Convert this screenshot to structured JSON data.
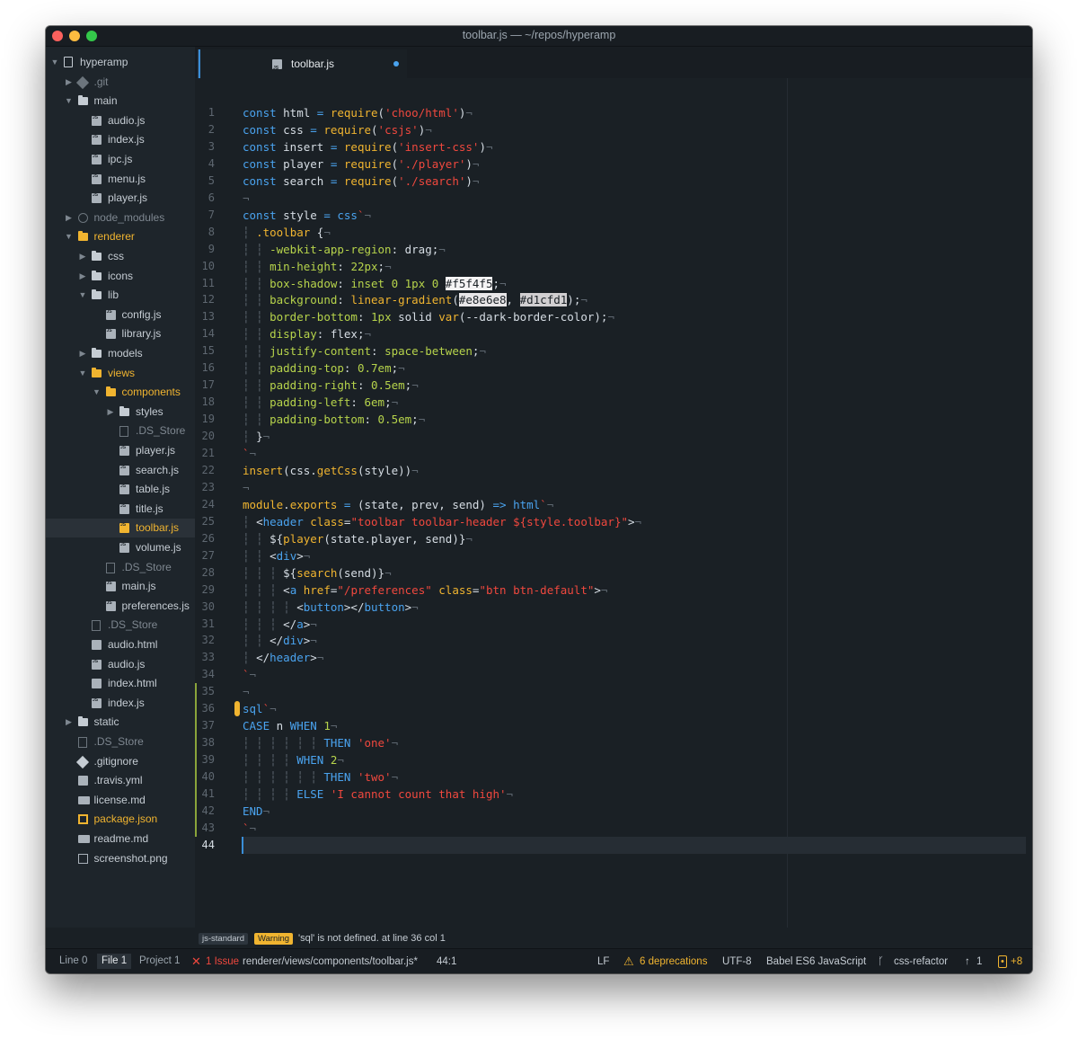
{
  "window": {
    "title": "toolbar.js — ~/repos/hyperamp"
  },
  "tree": [
    {
      "label": "hyperamp",
      "depth": 0,
      "arrow": "down",
      "icon": "repo-icon"
    },
    {
      "label": ".git",
      "depth": 1,
      "arrow": "right",
      "icon": "git-icon",
      "dim": true
    },
    {
      "label": "main",
      "depth": 1,
      "arrow": "down",
      "icon": "folder-icon"
    },
    {
      "label": "audio.js",
      "depth": 2,
      "icon": "js-file-icon"
    },
    {
      "label": "index.js",
      "depth": 2,
      "icon": "js-file-icon"
    },
    {
      "label": "ipc.js",
      "depth": 2,
      "icon": "js-file-icon"
    },
    {
      "label": "menu.js",
      "depth": 2,
      "icon": "js-file-icon"
    },
    {
      "label": "player.js",
      "depth": 2,
      "icon": "js-file-icon"
    },
    {
      "label": "node_modules",
      "depth": 1,
      "arrow": "right",
      "icon": "node-modules-icon",
      "dim": true
    },
    {
      "label": "renderer",
      "depth": 1,
      "arrow": "down",
      "icon": "folder-icon",
      "gold": true
    },
    {
      "label": "css",
      "depth": 2,
      "arrow": "right",
      "icon": "folder-icon"
    },
    {
      "label": "icons",
      "depth": 2,
      "arrow": "right",
      "icon": "folder-icon"
    },
    {
      "label": "lib",
      "depth": 2,
      "arrow": "down",
      "icon": "folder-icon"
    },
    {
      "label": "config.js",
      "depth": 3,
      "icon": "js-file-icon"
    },
    {
      "label": "library.js",
      "depth": 3,
      "icon": "js-file-icon"
    },
    {
      "label": "models",
      "depth": 2,
      "arrow": "right",
      "icon": "folder-icon"
    },
    {
      "label": "views",
      "depth": 2,
      "arrow": "down",
      "icon": "folder-icon",
      "gold": true
    },
    {
      "label": "components",
      "depth": 3,
      "arrow": "down",
      "icon": "folder-icon",
      "gold": true
    },
    {
      "label": "styles",
      "depth": 4,
      "arrow": "right",
      "icon": "folder-icon"
    },
    {
      "label": ".DS_Store",
      "depth": 4,
      "icon": "plain-file-icon",
      "dim": true
    },
    {
      "label": "player.js",
      "depth": 4,
      "icon": "js-file-icon"
    },
    {
      "label": "search.js",
      "depth": 4,
      "icon": "js-file-icon"
    },
    {
      "label": "table.js",
      "depth": 4,
      "icon": "js-file-icon"
    },
    {
      "label": "title.js",
      "depth": 4,
      "icon": "js-file-icon"
    },
    {
      "label": "toolbar.js",
      "depth": 4,
      "icon": "js-file-icon",
      "gold": true,
      "selected": true
    },
    {
      "label": "volume.js",
      "depth": 4,
      "icon": "js-file-icon"
    },
    {
      "label": ".DS_Store",
      "depth": 3,
      "icon": "plain-file-icon",
      "dim": true
    },
    {
      "label": "main.js",
      "depth": 3,
      "icon": "js-file-icon"
    },
    {
      "label": "preferences.js",
      "depth": 3,
      "icon": "js-file-icon"
    },
    {
      "label": ".DS_Store",
      "depth": 2,
      "icon": "plain-file-icon",
      "dim": true
    },
    {
      "label": "audio.html",
      "depth": 2,
      "icon": "html-file-icon"
    },
    {
      "label": "audio.js",
      "depth": 2,
      "icon": "js-file-icon"
    },
    {
      "label": "index.html",
      "depth": 2,
      "icon": "html-file-icon"
    },
    {
      "label": "index.js",
      "depth": 2,
      "icon": "js-file-icon"
    },
    {
      "label": "static",
      "depth": 1,
      "arrow": "right",
      "icon": "folder-icon"
    },
    {
      "label": ".DS_Store",
      "depth": 1,
      "icon": "plain-file-icon",
      "dim": true
    },
    {
      "label": ".gitignore",
      "depth": 1,
      "icon": "git-icon"
    },
    {
      "label": ".travis.yml",
      "depth": 1,
      "icon": "yml-file-icon"
    },
    {
      "label": "license.md",
      "depth": 1,
      "icon": "md-file-icon"
    },
    {
      "label": "package.json",
      "depth": 1,
      "icon": "json-file-icon",
      "gold": true
    },
    {
      "label": "readme.md",
      "depth": 1,
      "icon": "md-file-icon"
    },
    {
      "label": "screenshot.png",
      "depth": 1,
      "icon": "image-file-icon"
    }
  ],
  "tab": {
    "label": "toolbar.js",
    "modified": true
  },
  "editor": {
    "active_line": 44,
    "warning_line": 36,
    "modified_lines": [
      35,
      43
    ],
    "lines": [
      [
        [
          "k",
          "const "
        ],
        [
          "p",
          "html "
        ],
        [
          "k",
          "= "
        ],
        [
          "f",
          "require"
        ],
        [
          "p",
          "("
        ],
        [
          "s",
          "'choo/html'"
        ],
        [
          "p",
          ")"
        ],
        [
          "inv",
          "¬"
        ]
      ],
      [
        [
          "k",
          "const "
        ],
        [
          "p",
          "css "
        ],
        [
          "k",
          "= "
        ],
        [
          "f",
          "require"
        ],
        [
          "p",
          "("
        ],
        [
          "s",
          "'csjs'"
        ],
        [
          "p",
          ")"
        ],
        [
          "inv",
          "¬"
        ]
      ],
      [
        [
          "k",
          "const "
        ],
        [
          "p",
          "insert "
        ],
        [
          "k",
          "= "
        ],
        [
          "f",
          "require"
        ],
        [
          "p",
          "("
        ],
        [
          "s",
          "'insert-css'"
        ],
        [
          "p",
          ")"
        ],
        [
          "inv",
          "¬"
        ]
      ],
      [
        [
          "k",
          "const "
        ],
        [
          "p",
          "player "
        ],
        [
          "k",
          "= "
        ],
        [
          "f",
          "require"
        ],
        [
          "p",
          "("
        ],
        [
          "s",
          "'./player'"
        ],
        [
          "p",
          ")"
        ],
        [
          "inv",
          "¬"
        ]
      ],
      [
        [
          "k",
          "const "
        ],
        [
          "p",
          "search "
        ],
        [
          "k",
          "= "
        ],
        [
          "f",
          "require"
        ],
        [
          "p",
          "("
        ],
        [
          "s",
          "'./search'"
        ],
        [
          "p",
          ")"
        ],
        [
          "inv",
          "¬"
        ]
      ],
      [
        [
          "inv",
          "¬"
        ]
      ],
      [
        [
          "k",
          "const "
        ],
        [
          "p",
          "style "
        ],
        [
          "k",
          "= "
        ],
        [
          "k",
          "css"
        ],
        [
          "s",
          "`"
        ],
        [
          "inv",
          "¬"
        ]
      ],
      [
        [
          "inv",
          "┆ "
        ],
        [
          "y",
          ".toolbar "
        ],
        [
          "p",
          "{"
        ],
        [
          "inv",
          "¬"
        ]
      ],
      [
        [
          "inv",
          "┆ ┆ "
        ],
        [
          "pr",
          "-webkit-app-region"
        ],
        [
          "p",
          ": drag;"
        ],
        [
          "inv",
          "¬"
        ]
      ],
      [
        [
          "inv",
          "┆ ┆ "
        ],
        [
          "pr",
          "min-height"
        ],
        [
          "p",
          ": "
        ],
        [
          "n",
          "22px"
        ],
        [
          "p",
          ";"
        ],
        [
          "inv",
          "¬"
        ]
      ],
      [
        [
          "inv",
          "┆ ┆ "
        ],
        [
          "pr",
          "box-shadow"
        ],
        [
          "p",
          ": "
        ],
        [
          "n",
          "inset 0 1px 0 "
        ],
        [
          "sw-w",
          "#f5f4f5"
        ],
        [
          "p",
          ";"
        ],
        [
          "inv",
          "¬"
        ]
      ],
      [
        [
          "inv",
          "┆ ┆ "
        ],
        [
          "pr",
          "background"
        ],
        [
          "p",
          ": "
        ],
        [
          "f",
          "linear-gradient"
        ],
        [
          "p",
          "("
        ],
        [
          "sw-g",
          "#e8e6e8"
        ],
        [
          "p",
          ", "
        ],
        [
          "sw-d",
          "#d1cfd1"
        ],
        [
          "p",
          ");"
        ],
        [
          "inv",
          "¬"
        ]
      ],
      [
        [
          "inv",
          "┆ ┆ "
        ],
        [
          "pr",
          "border-bottom"
        ],
        [
          "p",
          ": "
        ],
        [
          "n",
          "1px "
        ],
        [
          "p",
          "solid "
        ],
        [
          "f",
          "var"
        ],
        [
          "p",
          "(--dark-border-color);"
        ],
        [
          "inv",
          "¬"
        ]
      ],
      [
        [
          "inv",
          "┆ ┆ "
        ],
        [
          "pr",
          "display"
        ],
        [
          "p",
          ": flex;"
        ],
        [
          "inv",
          "¬"
        ]
      ],
      [
        [
          "inv",
          "┆ ┆ "
        ],
        [
          "pr",
          "justify-content"
        ],
        [
          "p",
          ": "
        ],
        [
          "n",
          "space-between"
        ],
        [
          "p",
          ";"
        ],
        [
          "inv",
          "¬"
        ]
      ],
      [
        [
          "inv",
          "┆ ┆ "
        ],
        [
          "pr",
          "padding-top"
        ],
        [
          "p",
          ": "
        ],
        [
          "n",
          "0.7em"
        ],
        [
          "p",
          ";"
        ],
        [
          "inv",
          "¬"
        ]
      ],
      [
        [
          "inv",
          "┆ ┆ "
        ],
        [
          "pr",
          "padding-right"
        ],
        [
          "p",
          ": "
        ],
        [
          "n",
          "0.5em"
        ],
        [
          "p",
          ";"
        ],
        [
          "inv",
          "¬"
        ]
      ],
      [
        [
          "inv",
          "┆ ┆ "
        ],
        [
          "pr",
          "padding-left"
        ],
        [
          "p",
          ": "
        ],
        [
          "n",
          "6em"
        ],
        [
          "p",
          ";"
        ],
        [
          "inv",
          "¬"
        ]
      ],
      [
        [
          "inv",
          "┆ ┆ "
        ],
        [
          "pr",
          "padding-bottom"
        ],
        [
          "p",
          ": "
        ],
        [
          "n",
          "0.5em"
        ],
        [
          "p",
          ";"
        ],
        [
          "inv",
          "¬"
        ]
      ],
      [
        [
          "inv",
          "┆ "
        ],
        [
          "p",
          "}"
        ],
        [
          "inv",
          "¬"
        ]
      ],
      [
        [
          "s",
          "`"
        ],
        [
          "inv",
          "¬"
        ]
      ],
      [
        [
          "f",
          "insert"
        ],
        [
          "p",
          "(css."
        ],
        [
          "f",
          "getCss"
        ],
        [
          "p",
          "(style))"
        ],
        [
          "inv",
          "¬"
        ]
      ],
      [
        [
          "inv",
          "¬"
        ]
      ],
      [
        [
          "f",
          "module"
        ],
        [
          "p",
          "."
        ],
        [
          "f",
          "exports "
        ],
        [
          "k",
          "= "
        ],
        [
          "p",
          "(state, prev, send) "
        ],
        [
          "k",
          "=> "
        ],
        [
          "k",
          "html"
        ],
        [
          "s",
          "`"
        ],
        [
          "inv",
          "¬"
        ]
      ],
      [
        [
          "inv",
          "┆ "
        ],
        [
          "p",
          "<"
        ],
        [
          "k",
          "header "
        ],
        [
          "y",
          "class"
        ],
        [
          "p",
          "="
        ],
        [
          "s",
          "\"toolbar toolbar-header ${style.toolbar}\""
        ],
        [
          "p",
          ">"
        ],
        [
          "inv",
          "¬"
        ]
      ],
      [
        [
          "inv",
          "┆ ┆ "
        ],
        [
          "p",
          "${"
        ],
        [
          "f",
          "player"
        ],
        [
          "p",
          "(state.player, send)}"
        ],
        [
          "inv",
          "¬"
        ]
      ],
      [
        [
          "inv",
          "┆ ┆ "
        ],
        [
          "p",
          "<"
        ],
        [
          "k",
          "div"
        ],
        [
          "p",
          ">"
        ],
        [
          "inv",
          "¬"
        ]
      ],
      [
        [
          "inv",
          "┆ ┆ ┆ "
        ],
        [
          "p",
          "${"
        ],
        [
          "f",
          "search"
        ],
        [
          "p",
          "(send)}"
        ],
        [
          "inv",
          "¬"
        ]
      ],
      [
        [
          "inv",
          "┆ ┆ ┆ "
        ],
        [
          "p",
          "<"
        ],
        [
          "k",
          "a "
        ],
        [
          "y",
          "href"
        ],
        [
          "p",
          "="
        ],
        [
          "s",
          "\"/preferences\" "
        ],
        [
          "y",
          "class"
        ],
        [
          "p",
          "="
        ],
        [
          "s",
          "\"btn btn-default\""
        ],
        [
          "p",
          ">"
        ],
        [
          "inv",
          "¬"
        ]
      ],
      [
        [
          "inv",
          "┆ ┆ ┆ ┆ "
        ],
        [
          "p",
          "<"
        ],
        [
          "k",
          "button"
        ],
        [
          "p",
          "></"
        ],
        [
          "k",
          "button"
        ],
        [
          "p",
          ">"
        ],
        [
          "inv",
          "¬"
        ]
      ],
      [
        [
          "inv",
          "┆ ┆ ┆ "
        ],
        [
          "p",
          "</"
        ],
        [
          "k",
          "a"
        ],
        [
          "p",
          ">"
        ],
        [
          "inv",
          "¬"
        ]
      ],
      [
        [
          "inv",
          "┆ ┆ "
        ],
        [
          "p",
          "</"
        ],
        [
          "k",
          "div"
        ],
        [
          "p",
          ">"
        ],
        [
          "inv",
          "¬"
        ]
      ],
      [
        [
          "inv",
          "┆ "
        ],
        [
          "p",
          "</"
        ],
        [
          "k",
          "header"
        ],
        [
          "p",
          ">"
        ],
        [
          "inv",
          "¬"
        ]
      ],
      [
        [
          "s",
          "`"
        ],
        [
          "inv",
          "¬"
        ]
      ],
      [
        [
          "inv",
          "¬"
        ]
      ],
      [
        [
          "k",
          "sql"
        ],
        [
          "s",
          "`"
        ],
        [
          "inv",
          "¬"
        ]
      ],
      [
        [
          "sqlk",
          "CASE "
        ],
        [
          "p",
          "n "
        ],
        [
          "sqlk",
          "WHEN "
        ],
        [
          "n",
          "1"
        ],
        [
          "inv",
          "¬"
        ]
      ],
      [
        [
          "inv",
          "┆ ┆ ┆ ┆ ┆ ┆ "
        ],
        [
          "sqlk",
          "THEN "
        ],
        [
          "s",
          "'one'"
        ],
        [
          "inv",
          "¬"
        ]
      ],
      [
        [
          "inv",
          "┆ ┆ ┆ ┆ "
        ],
        [
          "sqlk",
          "WHEN "
        ],
        [
          "n",
          "2"
        ],
        [
          "inv",
          "¬"
        ]
      ],
      [
        [
          "inv",
          "┆ ┆ ┆ ┆ ┆ ┆ "
        ],
        [
          "sqlk",
          "THEN "
        ],
        [
          "s",
          "'two'"
        ],
        [
          "inv",
          "¬"
        ]
      ],
      [
        [
          "inv",
          "┆ ┆ ┆ ┆ "
        ],
        [
          "sqlk",
          "ELSE "
        ],
        [
          "s",
          "'I cannot count that high'"
        ],
        [
          "inv",
          "¬"
        ]
      ],
      [
        [
          "sqlk",
          "END"
        ],
        [
          "inv",
          "¬"
        ]
      ],
      [
        [
          "s",
          "`"
        ],
        [
          "inv",
          "¬"
        ]
      ],
      []
    ]
  },
  "linter": {
    "source": "js-standard",
    "level": "Warning",
    "message": "'sql' is not defined.",
    "location": "at line 36 col 1"
  },
  "status": {
    "line_tab": "Line",
    "line_count": "0",
    "file_tab": "File",
    "file_count": "1",
    "project_tab": "Project",
    "project_count": "1",
    "issues": "1 Issue",
    "path": "renderer/views/components/toolbar.js*",
    "cursor": "44:1",
    "line_ending": "LF",
    "deprecations": "6 deprecations",
    "encoding": "UTF-8",
    "grammar": "Babel ES6 JavaScript",
    "branch": "css-refactor",
    "ahead": "1",
    "changes": "+8"
  },
  "colors": {
    "background": "#1a2025",
    "sidebar": "#1e252b",
    "keyword": "#4aa3ef",
    "function": "#f0b430",
    "string": "#f0483e",
    "number": "#b6d34b",
    "warning": "#f0b430",
    "error": "#f0483e"
  }
}
